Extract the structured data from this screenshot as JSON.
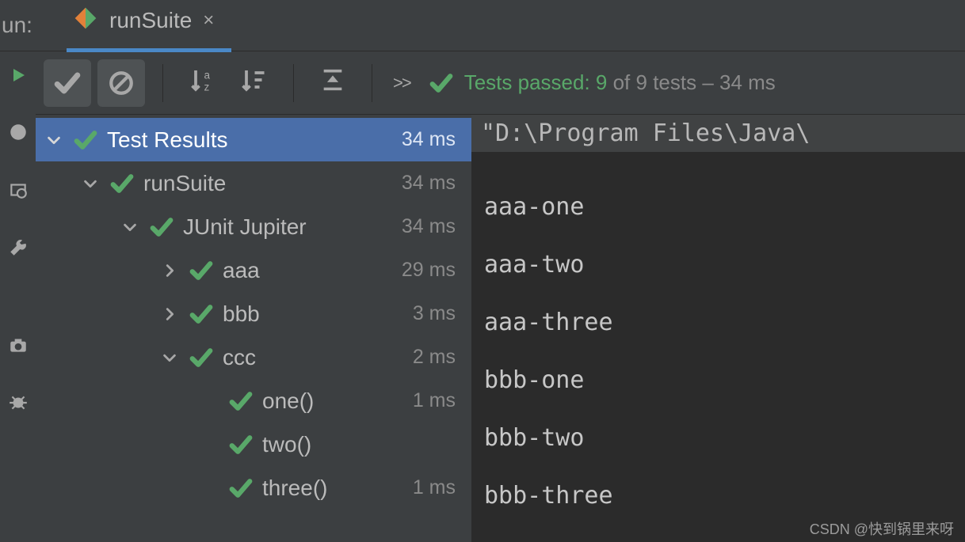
{
  "run_label": "un:",
  "tab": {
    "name": "runSuite"
  },
  "toolbar": {
    "more": ">>"
  },
  "summary": {
    "prefix": "Tests passed: ",
    "passed": "9",
    "of_text": " of 9 tests – 34 ms"
  },
  "tree": {
    "root": {
      "label": "Test Results",
      "time": "34 ms"
    },
    "n1": {
      "label": "runSuite",
      "time": "34 ms"
    },
    "n2": {
      "label": "JUnit Jupiter",
      "time": "34 ms"
    },
    "n3": {
      "label": "aaa",
      "time": "29 ms"
    },
    "n4": {
      "label": "bbb",
      "time": "3 ms"
    },
    "n5": {
      "label": "ccc",
      "time": "2 ms"
    },
    "n6": {
      "label": "one()",
      "time": "1 ms"
    },
    "n7": {
      "label": "two()",
      "time": ""
    },
    "n8": {
      "label": "three()",
      "time": "1 ms"
    }
  },
  "console": {
    "header": "\"D:\\Program Files\\Java\\",
    "lines": {
      "l0": "aaa-one",
      "l1": "aaa-two",
      "l2": "aaa-three",
      "l3": "bbb-one",
      "l4": "bbb-two",
      "l5": "bbb-three"
    }
  },
  "watermark": "CSDN @快到锅里来呀"
}
